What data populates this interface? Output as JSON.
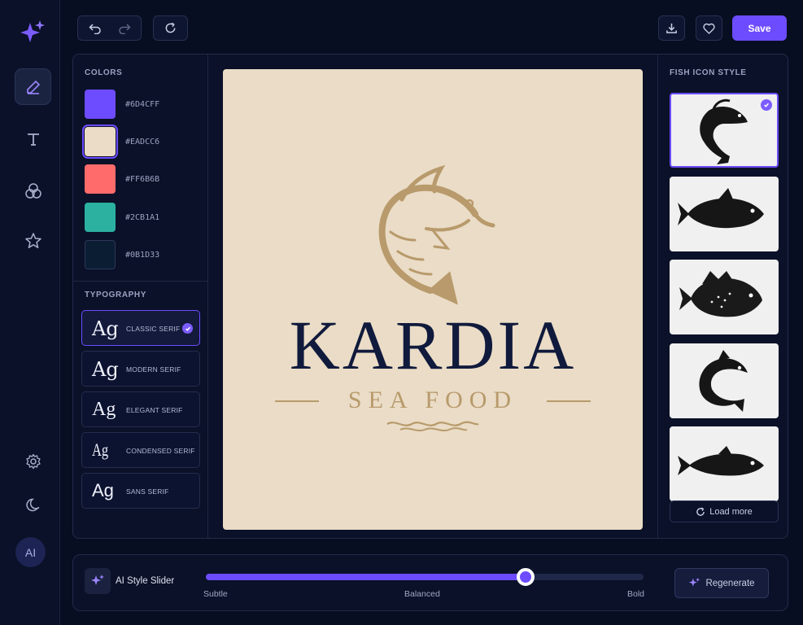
{
  "toolbar": {
    "save_label": "Save"
  },
  "colors": {
    "title": "COLORS",
    "swatches": [
      {
        "hex": "#6D4CFF",
        "color": "#6d4cff"
      },
      {
        "hex": "#EADCC6",
        "color": "#eadcc6"
      },
      {
        "hex": "#FF6B6B",
        "color": "#ff6b6b"
      },
      {
        "hex": "#2CB1A1",
        "color": "#2cb1a1"
      },
      {
        "hex": "#0B1D33",
        "color": "#0b1d33"
      }
    ],
    "selected_index": 1
  },
  "typography": {
    "title": "TYPOGRAPHY",
    "sample": "Ag",
    "fonts": [
      {
        "name": "CLASSIC SERIF"
      },
      {
        "name": "MODERN SERIF"
      },
      {
        "name": "ELEGANT SERIF"
      },
      {
        "name": "CONDENSED SERIF"
      },
      {
        "name": "SANS SERIF"
      }
    ],
    "selected_index": 0
  },
  "artboard": {
    "brand": "KARDIA",
    "tagline": "SEA FOOD",
    "background": "#eadcc6",
    "brand_color": "#101a3c",
    "accent_color": "#b89a6c"
  },
  "fish_styles": {
    "title": "FISH ICON STYLE",
    "selected_index": 0,
    "load_more": "Load more"
  },
  "ai_slider": {
    "label": "AI Style Slider",
    "ticks": [
      "Subtle",
      "Balanced",
      "Bold"
    ],
    "value_percent": 73,
    "regenerate_label": "Regenerate"
  },
  "rail": {
    "ai_label": "AI"
  }
}
